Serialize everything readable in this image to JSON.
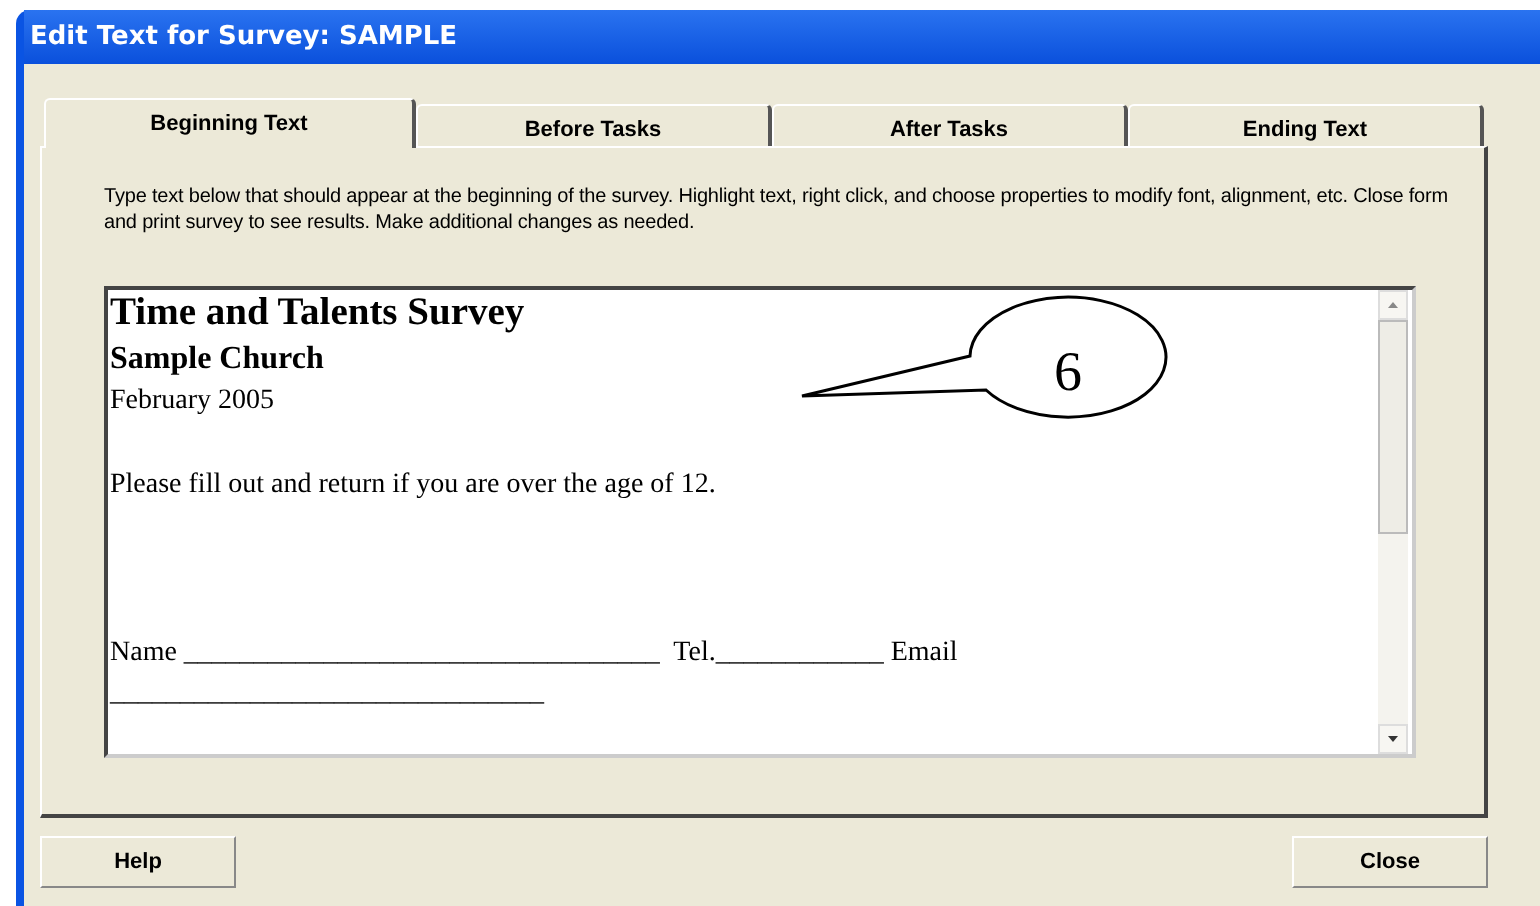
{
  "window": {
    "title": "Edit Text for Survey: SAMPLE"
  },
  "tabs": [
    {
      "label": "Beginning Text",
      "selected": true
    },
    {
      "label": "Before Tasks",
      "selected": false
    },
    {
      "label": "After Tasks",
      "selected": false
    },
    {
      "label": "Ending Text",
      "selected": false
    }
  ],
  "instructions": "Type text below that should appear at the beginning of the survey.   Highlight text, right click, and choose properties to modify font, alignment, etc.  Close form and print survey to see results.  Make additional changes as needed.",
  "editor": {
    "lines": [
      {
        "kind": "title",
        "text": "Time and Talents Survey"
      },
      {
        "kind": "subtitle",
        "text": "Sample Church"
      },
      {
        "kind": "body",
        "text": "February 2005"
      },
      {
        "kind": "blank"
      },
      {
        "kind": "body",
        "text": "Please fill out and return if you are over the age of 12."
      },
      {
        "kind": "blank"
      },
      {
        "kind": "blank"
      },
      {
        "kind": "blank"
      },
      {
        "kind": "body",
        "text": "Name __________________________________  Tel.____________ Email"
      },
      {
        "kind": "body",
        "text": "_______________________________"
      }
    ]
  },
  "callout": {
    "text": "6"
  },
  "buttons": [
    {
      "label": "Help"
    },
    {
      "label": "Close"
    }
  ]
}
